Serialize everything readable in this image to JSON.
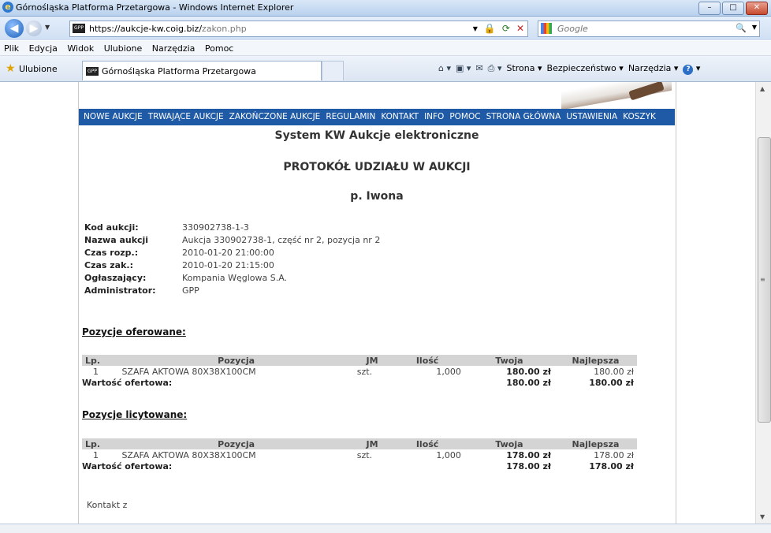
{
  "window": {
    "title": "Górnośląska Platforma Przetargowa - Windows Internet Explorer",
    "minimize": "–",
    "maximize": "□",
    "close": "✕"
  },
  "address": {
    "url_host": "https://aukcje-kw.coig.biz/",
    "url_path": "zakon.php",
    "favicon_text": "GPP"
  },
  "search": {
    "placeholder": "Google"
  },
  "menu": {
    "items": [
      "Plik",
      "Edycja",
      "Widok",
      "Ulubione",
      "Narzędzia",
      "Pomoc"
    ]
  },
  "favorites": {
    "label": "Ulubione",
    "tab_title": "Górnośląska Platforma Przetargowa",
    "cmd_strona": "Strona",
    "cmd_bezpieczenstwo": "Bezpieczeństwo",
    "cmd_narzedzia": "Narzędzia"
  },
  "nav": {
    "items": [
      "NOWE AUKCJE",
      "TRWAJĄCE AUKCJE",
      "ZAKOŃCZONE AUKCJE",
      "REGULAMIN",
      "KONTAKT",
      "INFO",
      "POMOC",
      "STRONA GŁÓWNA",
      "USTAWIENIA",
      "KOSZYK"
    ]
  },
  "headings": {
    "system": "System KW Aukcje elektroniczne",
    "protocol": "PROTOKÓŁ UDZIAŁU W AUKCJI",
    "user": "p. Iwona"
  },
  "details": [
    {
      "label": "Kod aukcji:",
      "value": "330902738-1-3"
    },
    {
      "label": "Nazwa aukcji",
      "value": "Aukcja 330902738-1, część nr 2, pozycja nr 2"
    },
    {
      "label": "Czas rozp.:",
      "value": "2010-01-20 21:00:00"
    },
    {
      "label": "Czas zak.:",
      "value": "2010-01-20 21:15:00"
    },
    {
      "label": "Ogłaszający:",
      "value": "Kompania Węglowa S.A."
    },
    {
      "label": "Administrator:",
      "value": "GPP"
    }
  ],
  "table_headers": {
    "lp": "Lp.",
    "pozycja": "Pozycja",
    "jm": "JM",
    "ilosc": "Ilość",
    "twoja": "Twoja",
    "najlepsza": "Najlepsza"
  },
  "offered": {
    "title": "Pozycje oferowane:",
    "row": {
      "lp": "1",
      "pozycja": "SZAFA AKTOWA 80X38X100CM",
      "jm": "szt.",
      "ilosc": "1,000",
      "twoja": "180.00 zł",
      "najlepsza": "180.00 zł"
    },
    "total_label": "Wartość ofertowa:",
    "total_twoja": "180.00 zł",
    "total_najlepsza": "180.00 zł"
  },
  "bid": {
    "title": "Pozycje licytowane:",
    "row": {
      "lp": "1",
      "pozycja": "SZAFA AKTOWA 80X38X100CM",
      "jm": "szt.",
      "ilosc": "1,000",
      "twoja": "178.00 zł",
      "najlepsza": "178.00 zł"
    },
    "total_label": "Wartość ofertowa:",
    "total_twoja": "178.00 zł",
    "total_najlepsza": "178.00 zł"
  },
  "contact": "Kontakt z"
}
